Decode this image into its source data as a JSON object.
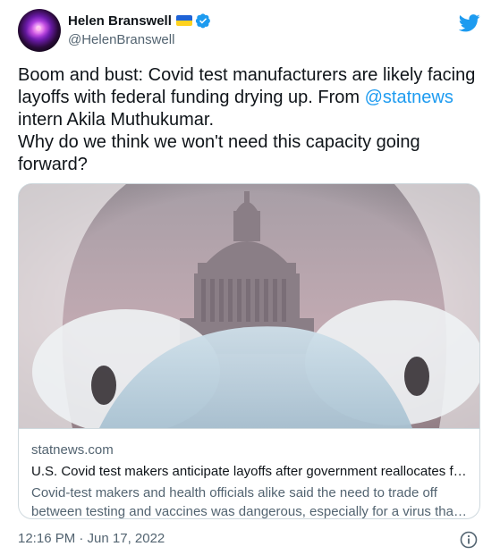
{
  "author": {
    "display_name": "Helen Branswell",
    "handle": "@HelenBranswell",
    "flag_icon": "ukraine-flag-icon",
    "verified_icon": "verified-badge-icon"
  },
  "tweet": {
    "line1": "Boom and bust: Covid test manufacturers are likely facing",
    "line2": "layoffs with federal funding drying up. From ",
    "mention": "@statnews",
    "line3": "intern Akila Muthukumar.",
    "line4": "Why do we think we won't need this capacity going",
    "line5": "forward?"
  },
  "card": {
    "domain": "statnews.com",
    "title": "U.S. Covid test makers anticipate layoffs after government reallocates fu...",
    "description_line1": "Covid-test makers and health officials alike said the need to trade off",
    "description_line2": "between testing and vaccines was dangerous, especially for a virus that i..."
  },
  "footer": {
    "timestamp": "12:16 PM · Jun 17, 2022",
    "info_icon": "info-icon"
  },
  "colors": {
    "link": "#1d9bf0",
    "twitter_blue": "#1d9bf0",
    "secondary_text": "#536471",
    "border": "#cfd9de"
  }
}
